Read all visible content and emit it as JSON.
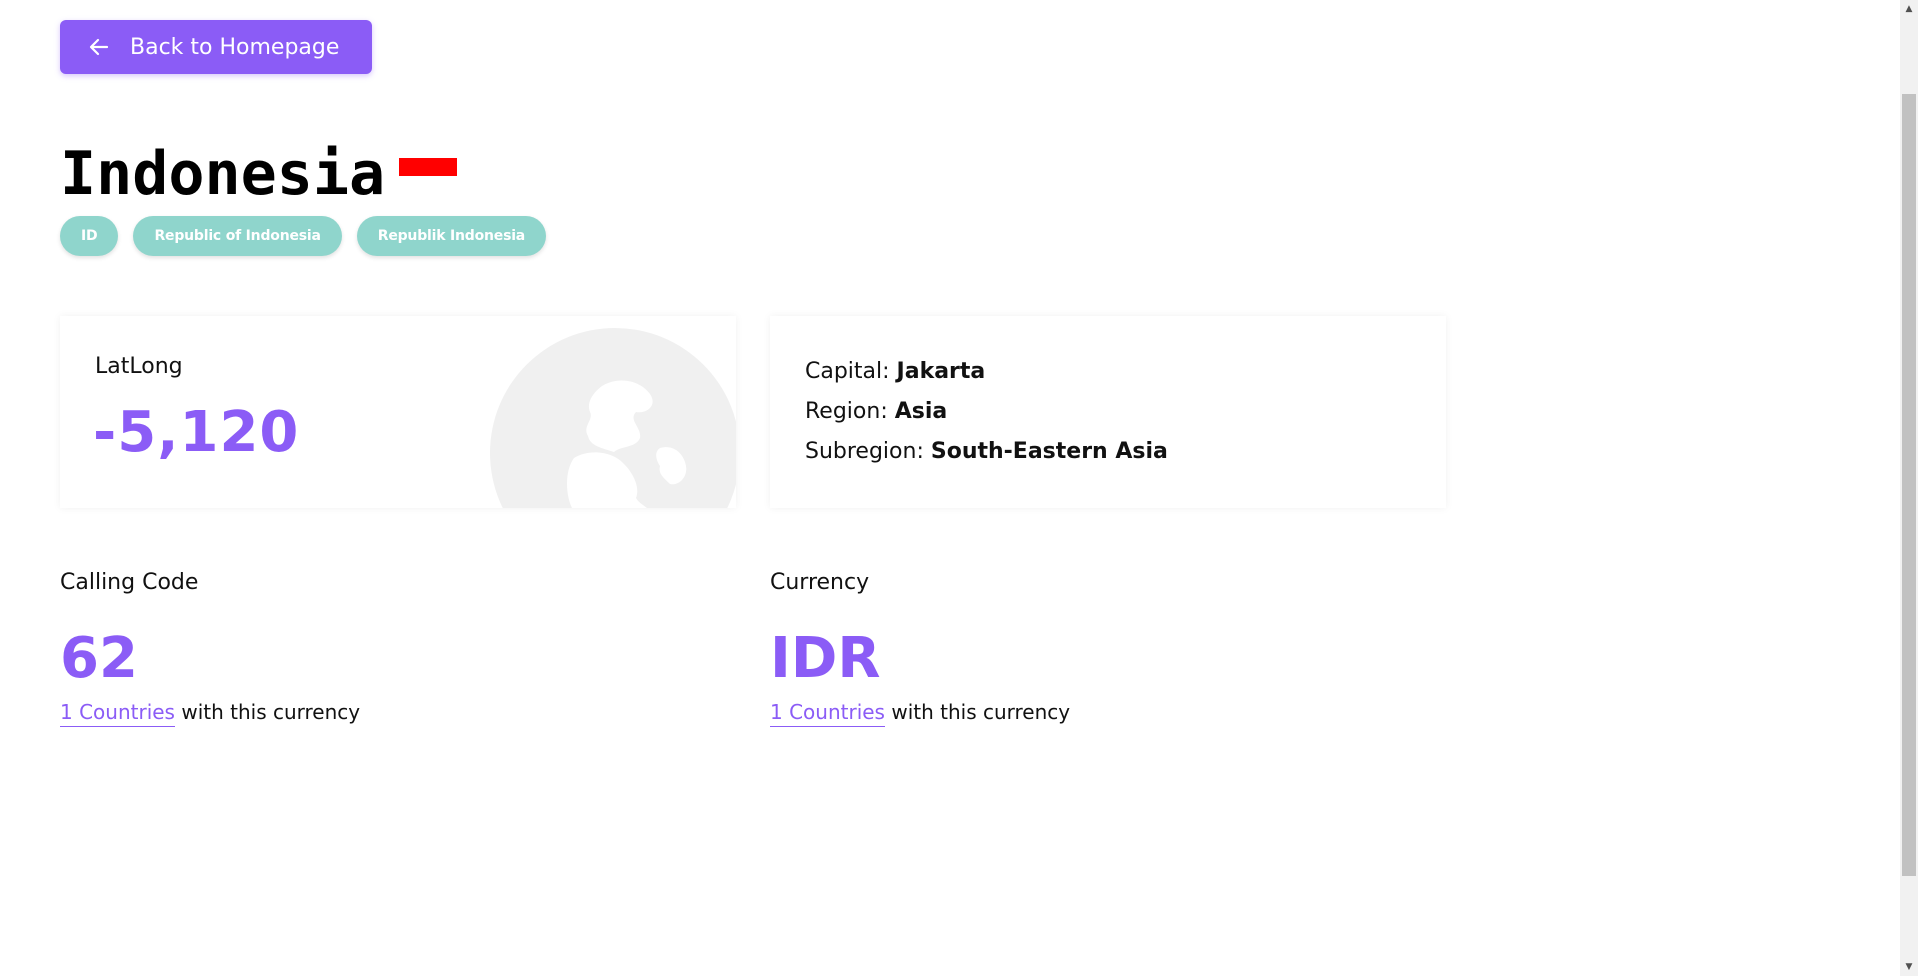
{
  "back_button": {
    "label": "Back to Homepage",
    "icon": "arrow-left-icon"
  },
  "country": {
    "name": "Indonesia",
    "flag_colors": [
      "#ff0000",
      "#ffffff"
    ],
    "tags": [
      "ID",
      "Republic of Indonesia",
      "Republik Indonesia"
    ]
  },
  "latlong_card": {
    "label": "LatLong",
    "value": "-5,120",
    "icon": "globe-icon"
  },
  "info_card": {
    "capital_label": "Capital: ",
    "capital": "Jakarta",
    "region_label": "Region: ",
    "region": "Asia",
    "subregion_label": "Subregion: ",
    "subregion": "South-Eastern Asia"
  },
  "calling_code": {
    "label": "Calling Code",
    "value": "62",
    "link_text": "1 Countries",
    "note": " with this currency"
  },
  "currency": {
    "label": "Currency",
    "value": "IDR",
    "link_text": "1 Countries",
    "note": " with this currency"
  },
  "colors": {
    "accent": "#8b5cf6",
    "tag": "#8fd5cc"
  }
}
